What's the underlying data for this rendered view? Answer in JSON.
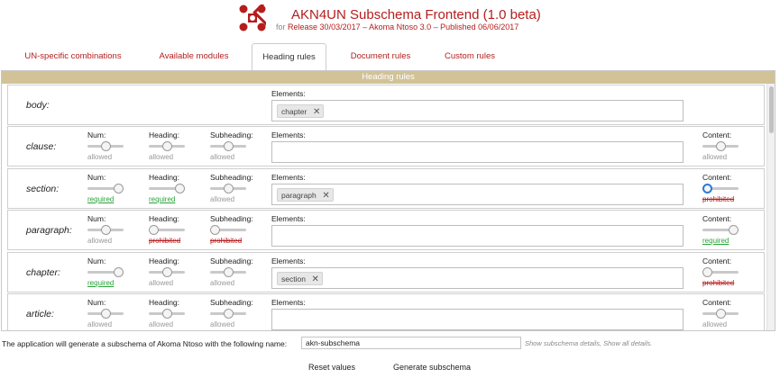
{
  "header": {
    "title": "AKN4UN Subschema Frontend (1.0 beta)",
    "subtitle_prefix": "for",
    "subtitle_release": "Release 30/03/2017 – Akoma Ntoso 3.0 – Published 06/06/2017",
    "logo_icon": "red-cross-logo-icon"
  },
  "tabs": [
    {
      "label": "UN-specific combinations",
      "active": false
    },
    {
      "label": "Available modules",
      "active": false
    },
    {
      "label": "Heading rules",
      "active": true
    },
    {
      "label": "Document rules",
      "active": false
    },
    {
      "label": "Custom rules",
      "active": false
    }
  ],
  "panel": {
    "title": "Heading rules",
    "labels": {
      "num": "Num:",
      "heading": "Heading:",
      "subheading": "Subheading:",
      "elements": "Elements:",
      "content": "Content:"
    }
  },
  "rules": [
    {
      "name": "body:",
      "controls": false,
      "elements": [
        "chapter"
      ]
    },
    {
      "name": "clause:",
      "controls": true,
      "num": {
        "level": 0.5,
        "status": "allowed"
      },
      "heading": {
        "level": 0.5,
        "status": "allowed"
      },
      "subheading": {
        "level": 0.5,
        "status": "allowed"
      },
      "elements": [],
      "content": {
        "level": 0.5,
        "status": "allowed"
      }
    },
    {
      "name": "section:",
      "controls": true,
      "num": {
        "level": 1,
        "status": "required"
      },
      "heading": {
        "level": 1,
        "status": "required"
      },
      "subheading": {
        "level": 0.5,
        "status": "allowed"
      },
      "elements": [
        "paragraph"
      ],
      "content": {
        "level": 0,
        "status": "prohibited",
        "focused": true
      }
    },
    {
      "name": "paragraph:",
      "controls": true,
      "num": {
        "level": 0.5,
        "status": "allowed"
      },
      "heading": {
        "level": 0,
        "status": "prohibited"
      },
      "subheading": {
        "level": 0,
        "status": "prohibited"
      },
      "elements": [],
      "content": {
        "level": 1,
        "status": "required"
      }
    },
    {
      "name": "chapter:",
      "controls": true,
      "num": {
        "level": 1,
        "status": "required"
      },
      "heading": {
        "level": 0.5,
        "status": "allowed"
      },
      "subheading": {
        "level": 0.5,
        "status": "allowed"
      },
      "elements": [
        "section"
      ],
      "content": {
        "level": 0,
        "status": "prohibited"
      }
    },
    {
      "name": "article:",
      "controls": true,
      "num": {
        "level": 0.5,
        "status": "allowed"
      },
      "heading": {
        "level": 0.5,
        "status": "allowed"
      },
      "subheading": {
        "level": 0.5,
        "status": "allowed"
      },
      "elements": [],
      "content": {
        "level": 0.5,
        "status": "allowed"
      }
    }
  ],
  "footer": {
    "name_label": "The application will generate a subschema of Akoma Ntoso with the following name:",
    "name_value": "akn-subschema",
    "details_text": "Show subschema details, Show all details.",
    "reset_label": "Reset values",
    "generate_label": "Generate subschema"
  },
  "colors": {
    "accent": "#b51d1d",
    "panel_header": "#d2c298",
    "required": "#2aa23a",
    "prohibited": "#b51d1d",
    "allowed": "#999999",
    "focus": "#2b7bd6"
  }
}
